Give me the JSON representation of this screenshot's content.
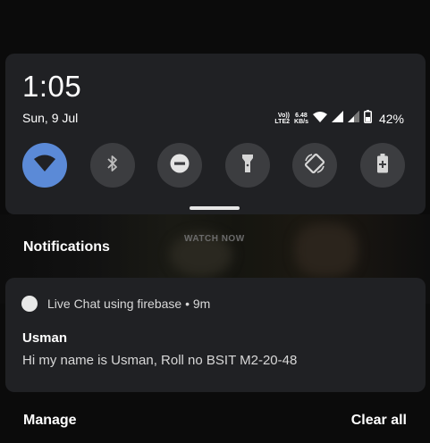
{
  "quick_settings": {
    "time": "1:05",
    "date": "Sun, 9 Jul",
    "status": {
      "volte_line1": "Vo))",
      "volte_line2": "LTE2",
      "speed_line1": "6.48",
      "speed_line2": "KB/s",
      "battery_percent": "42%",
      "icons": [
        "wifi-icon",
        "signal-icon",
        "signal-icon",
        "battery-icon"
      ]
    },
    "tiles": [
      {
        "name": "wifi",
        "icon": "wifi-icon",
        "active": true
      },
      {
        "name": "bluetooth",
        "icon": "bluetooth-icon",
        "active": false
      },
      {
        "name": "do-not-disturb",
        "icon": "do-not-disturb-icon",
        "active": false
      },
      {
        "name": "flashlight",
        "icon": "flashlight-icon",
        "active": false
      },
      {
        "name": "auto-rotate",
        "icon": "auto-rotate-icon",
        "active": false
      },
      {
        "name": "battery-saver",
        "icon": "battery-saver-icon",
        "active": false
      }
    ]
  },
  "background": {
    "watch_now": "WATCH NOW"
  },
  "notifications": {
    "header": "Notifications",
    "items": [
      {
        "app_line": "Live Chat using firebase • 9m",
        "title": "Usman",
        "body": "Hi my name is Usman, Roll no BSIT M2-20-48"
      }
    ],
    "manage_label": "Manage",
    "clear_all_label": "Clear all"
  },
  "colors": {
    "panel": "#202124",
    "tile_inactive": "#3c3d40",
    "tile_active": "#5b8ad7"
  }
}
